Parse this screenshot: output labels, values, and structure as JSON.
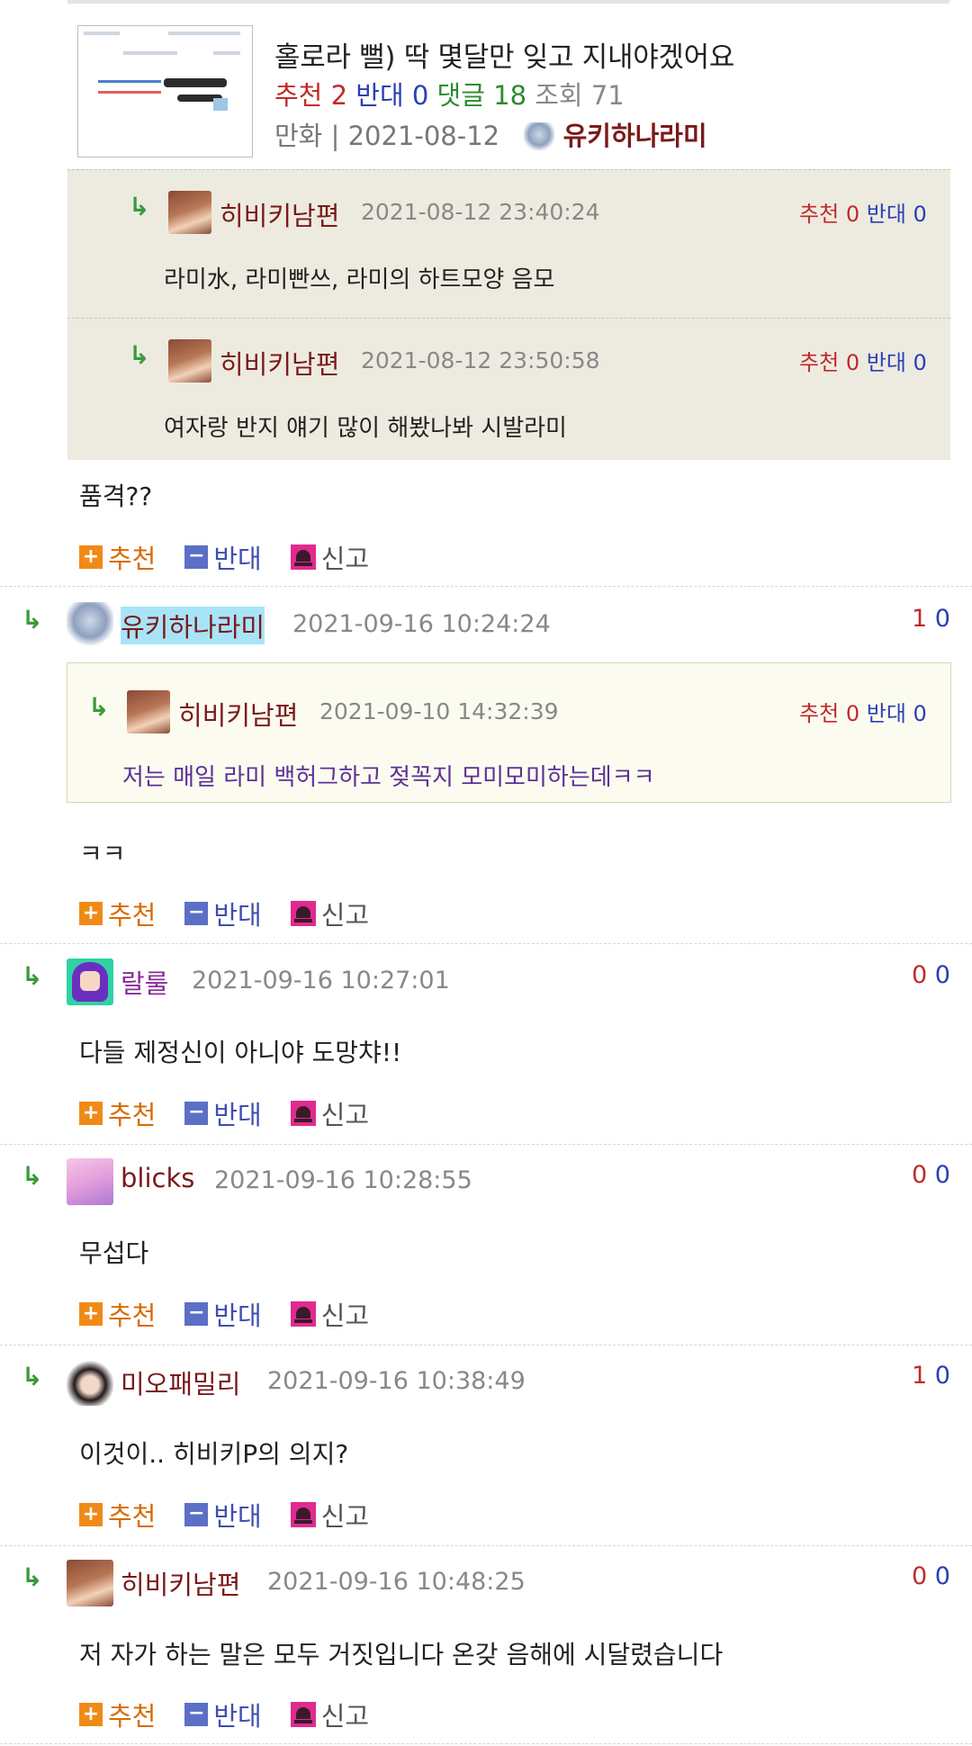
{
  "post": {
    "title": "홀로라 뻘) 딱 몇달만 잊고 지내야겠어요",
    "up_label": "추천",
    "up_count": "2",
    "down_label": "반대",
    "down_count": "0",
    "comment_label": "댓글",
    "comment_count": "18",
    "view_label": "조회",
    "view_count": "71",
    "category": "만화",
    "meta_sep": "|",
    "date": "2021-08-12",
    "author": "유키하나라미"
  },
  "quotes": [
    {
      "author": "히비키남편",
      "datetime": "2021-08-12 23:40:24",
      "up_label": "추천",
      "up": "0",
      "down_label": "반대",
      "down": "0",
      "text": "라미水, 라미빤쓰, 라미의 하트모양 음모"
    },
    {
      "author": "히비키남편",
      "datetime": "2021-08-12 23:50:58",
      "up_label": "추천",
      "up": "0",
      "down_label": "반대",
      "down": "0",
      "text": "여자랑 반지 얘기 많이 해봤나봐 시발라미"
    }
  ],
  "reply_arrow": "↳",
  "actions": {
    "up": "추천",
    "down": "반대",
    "report": "신고",
    "plus_glyph": "+",
    "minus_glyph": "−"
  },
  "comments": [
    {
      "text": "품격??"
    },
    {
      "author": "유키하나라미",
      "datetime": "2021-09-16 10:24:24",
      "up": "1",
      "down": "0",
      "nested": {
        "author": "히비키남편",
        "datetime": "2021-09-10 14:32:39",
        "up_label": "추천",
        "up": "0",
        "down_label": "반대",
        "down": "0",
        "text": "저는 매일 라미 백허그하고 젖꼭지 모미모미하는데ㅋㅋ"
      },
      "text": "ㅋㅋ"
    },
    {
      "author": "랄룰",
      "datetime": "2021-09-16 10:27:01",
      "up": "0",
      "down": "0",
      "text": "다들 제정신이 아니야 도망챠!!"
    },
    {
      "author": "blicks",
      "datetime": "2021-09-16 10:28:55",
      "up": "0",
      "down": "0",
      "text": "무섭다"
    },
    {
      "author": "미오패밀리",
      "datetime": "2021-09-16 10:38:49",
      "up": "1",
      "down": "0",
      "text": "이것이.. 히비키P의 의지?"
    },
    {
      "author": "히비키남편",
      "datetime": "2021-09-16 10:48:25",
      "up": "0",
      "down": "0",
      "text": "저 자가 하는 말은 모두 거짓입니다 온갖 음해에 시달렸습니다"
    }
  ]
}
